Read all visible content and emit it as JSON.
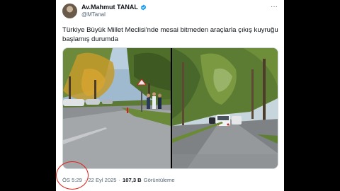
{
  "tweet": {
    "author_name": "Av.Mahmut TANAL",
    "handle": "@MTanal",
    "more_label": "···",
    "text": "Türkiye Büyük Millet Meclisi'nde mesai bitmeden araçlarla çıkış kuyruğu başlamış durumda",
    "time": "ÖS 5:29",
    "date": "22 Eyl 2025",
    "views_count": "107,3 B",
    "views_label": "Görüntüleme",
    "separator": "·"
  },
  "colors": {
    "verified": "#1d9bf0",
    "annotation_circle": "#e0241b",
    "secondary_text": "#536471"
  },
  "media": {
    "photos": [
      "street-photo-left",
      "street-photo-right"
    ]
  }
}
